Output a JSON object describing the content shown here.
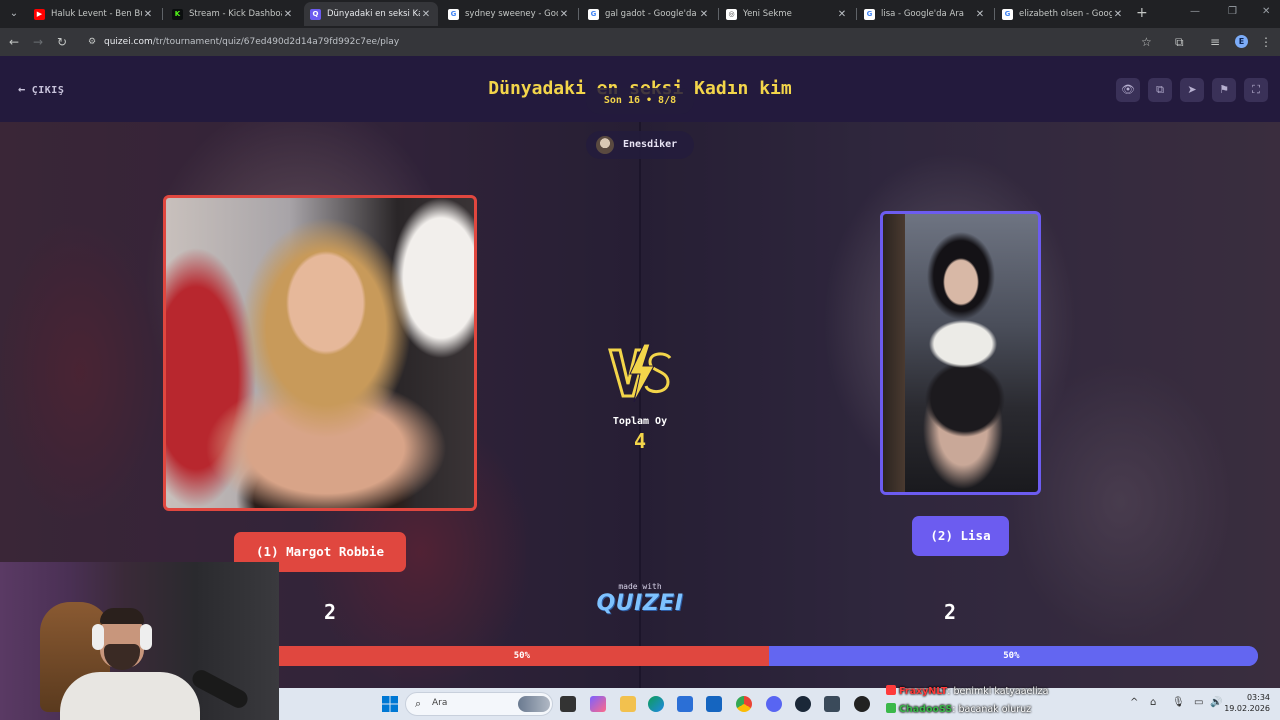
{
  "browser": {
    "tabs": [
      {
        "title": "Haluk Levent - Ben Bu Ga",
        "icon": "youtube-icon",
        "color": "#ff0000",
        "active": false
      },
      {
        "title": "Stream - Kick Dashboard",
        "icon": "kick-icon",
        "color": "#53fc18",
        "active": false
      },
      {
        "title": "Dünyadaki en seksi Kadın",
        "icon": "quizei-icon",
        "color": "#6c5cf0",
        "active": true
      },
      {
        "title": "sydney sweeney - Google",
        "icon": "google-icon",
        "color": "#ffffff",
        "active": false
      },
      {
        "title": "gal gadot - Google'da Ara",
        "icon": "google-icon",
        "color": "#ffffff",
        "active": false
      },
      {
        "title": "Yeni Sekme",
        "icon": "chrome-icon",
        "color": "#ffffff",
        "active": false
      },
      {
        "title": "lisa - Google'da Ara",
        "icon": "google-icon",
        "color": "#ffffff",
        "active": false
      },
      {
        "title": "elizabeth olsen - Google",
        "icon": "google-icon",
        "color": "#ffffff",
        "active": false
      }
    ],
    "url_host": "quizei.com",
    "url_path": "/tr/tournament/quiz/67ed490d2d14a79fd992c7ee/play",
    "profile_initial": "E"
  },
  "header": {
    "exit_label": "ÇIKIŞ",
    "title": "Dünyadaki en seksi Kadın kim",
    "icons": [
      "eye-icon",
      "copy-icon",
      "send-icon",
      "flag-icon",
      "fullscreen-icon"
    ]
  },
  "round": {
    "stage_label": "Son 16 • 8/8",
    "creator": "Enesdiker",
    "total_label": "Toplam Oy",
    "total_votes": "4"
  },
  "contestants": {
    "left": {
      "label": "(1) Margot Robbie",
      "votes": "2",
      "percent_label": "50%",
      "share": 0.5,
      "color": "#e0473f"
    },
    "right": {
      "label": "(2) Lisa",
      "votes": "2",
      "percent_label": "50%",
      "share": 0.5,
      "color": "#6c5cf0"
    }
  },
  "branding": {
    "made_with": "made with",
    "logo": "QUIZEI"
  },
  "taskbar": {
    "search_placeholder": "Ara",
    "time": "03:34",
    "date": "19.02.2026"
  },
  "chat": [
    {
      "user": "FraxyNLT",
      "text": ": benimki katyaaeliza"
    },
    {
      "user": "ChadooSS",
      "text": ": bacanak oluruz"
    }
  ]
}
